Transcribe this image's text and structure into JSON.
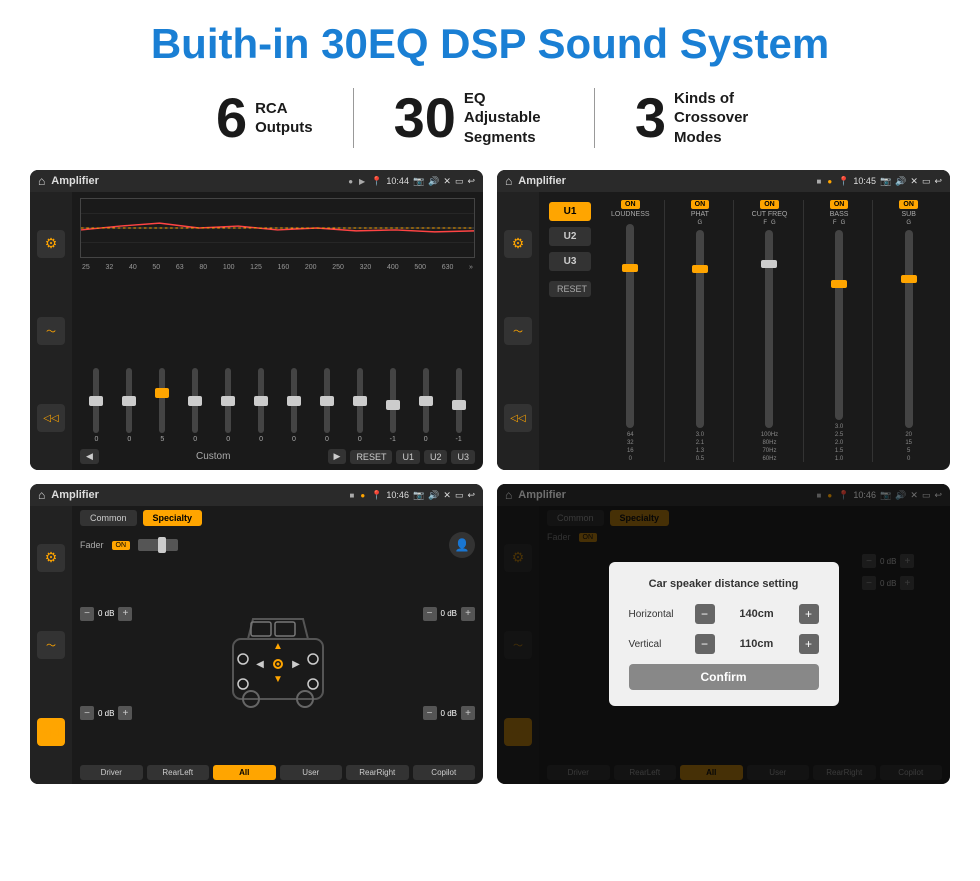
{
  "page": {
    "title": "Buith-in 30EQ DSP Sound System",
    "background": "#ffffff"
  },
  "stats": [
    {
      "number": "6",
      "text": "RCA\nOutputs"
    },
    {
      "number": "30",
      "text": "EQ Adjustable\nSegments"
    },
    {
      "number": "3",
      "text": "Kinds of\nCrossover Modes"
    }
  ],
  "screen1": {
    "app": "Amplifier",
    "time": "10:44",
    "eq_bands": [
      "25",
      "32",
      "40",
      "50",
      "63",
      "80",
      "100",
      "125",
      "160",
      "200",
      "250",
      "320",
      "400",
      "500",
      "630"
    ],
    "eq_values": [
      "0",
      "0",
      "0",
      "5",
      "0",
      "0",
      "0",
      "0",
      "0",
      "0",
      "0",
      "-1",
      "0",
      "-1"
    ],
    "buttons": [
      "Custom",
      "RESET",
      "U1",
      "U2",
      "U3"
    ]
  },
  "screen2": {
    "app": "Amplifier",
    "time": "10:45",
    "u_buttons": [
      "U1",
      "U2",
      "U3"
    ],
    "controls": [
      "LOUDNESS",
      "PHAT",
      "CUT FREQ",
      "BASS",
      "SUB"
    ],
    "on_labels": [
      "ON",
      "ON",
      "ON",
      "ON",
      "ON"
    ],
    "reset_btn": "RESET"
  },
  "screen3": {
    "app": "Amplifier",
    "time": "10:46",
    "tabs": [
      "Common",
      "Specialty"
    ],
    "fader_label": "Fader",
    "on_label": "ON",
    "volumes": [
      "0 dB",
      "0 dB",
      "0 dB",
      "0 dB"
    ],
    "buttons": [
      "Driver",
      "RearLeft",
      "All",
      "User",
      "RearRight",
      "Copilot"
    ]
  },
  "screen4": {
    "app": "Amplifier",
    "time": "10:46",
    "tabs": [
      "Common",
      "Specialty"
    ],
    "on_label": "ON",
    "dialog": {
      "title": "Car speaker distance setting",
      "horizontal_label": "Horizontal",
      "horizontal_value": "140cm",
      "vertical_label": "Vertical",
      "vertical_value": "110cm",
      "confirm_btn": "Confirm"
    },
    "volumes": [
      "0 dB",
      "0 dB"
    ],
    "buttons": [
      "Driver",
      "RearLeft",
      "User",
      "RearRight",
      "Copilot"
    ]
  }
}
